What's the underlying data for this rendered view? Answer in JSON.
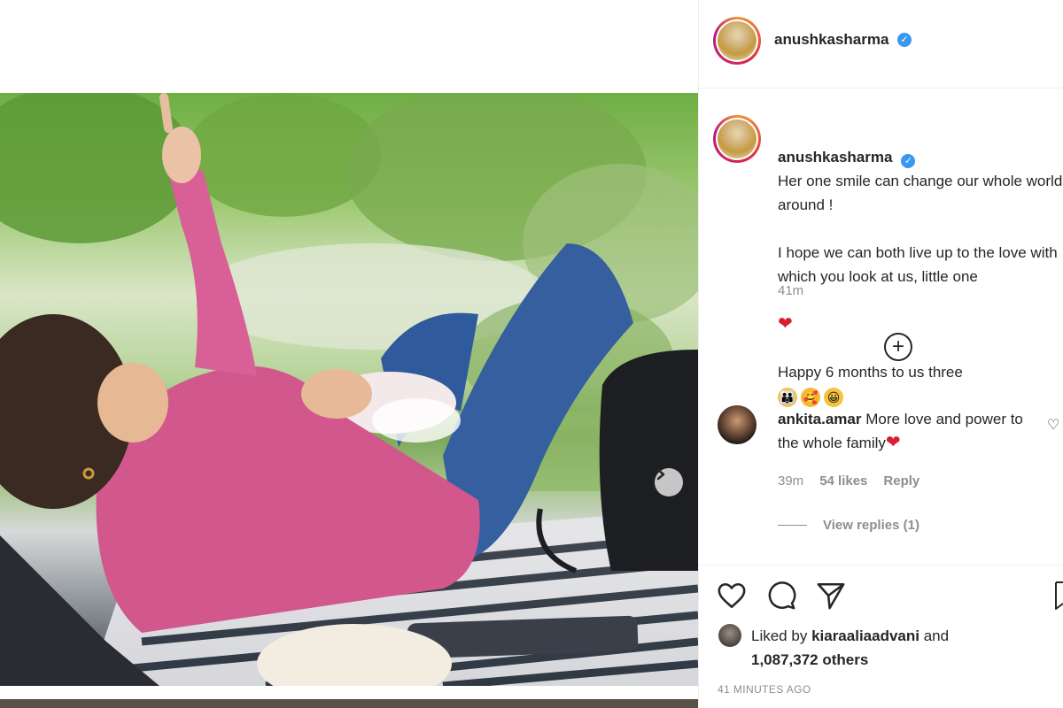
{
  "post_header": {
    "username": "anushkasharma",
    "verified": true
  },
  "caption": {
    "username": "anushkasharma",
    "line1": "Her one smile can change our whole world around !",
    "line2": "I hope we can both live up to the love with which you look at us, little one",
    "heart_emoji": "❤",
    "line3": "Happy 6 months to us three",
    "emojis": [
      "family-emoji",
      "smiling-face-with-hearts-emoji",
      "grinning-face-emoji"
    ],
    "time": "41m"
  },
  "load_more_icon": "plus-circle-icon",
  "comments": [
    {
      "username": "ankita.amar",
      "text": "More love and power to the whole family",
      "emoji": "❤",
      "time": "39m",
      "likes": "54 likes",
      "reply_label": "Reply",
      "view_replies": "View replies (1)"
    }
  ],
  "actions": {
    "like_icon": "heart-outline-icon",
    "comment_icon": "comment-bubble-icon",
    "share_icon": "paper-plane-icon",
    "save_icon": "bookmark-icon"
  },
  "likes_summary": {
    "prefix": "Liked by",
    "liker": "kiaraaliaadvani",
    "conjunction": "and",
    "others": "1,087,372 others"
  },
  "post_time": "41 MINUTES AGO",
  "carousel_next_icon": "chevron-right-icon",
  "colors": {
    "text": "#262626",
    "muted": "#8e8e8e",
    "verified": "#3897f0",
    "heart": "#d62030",
    "divider": "#efefef"
  }
}
